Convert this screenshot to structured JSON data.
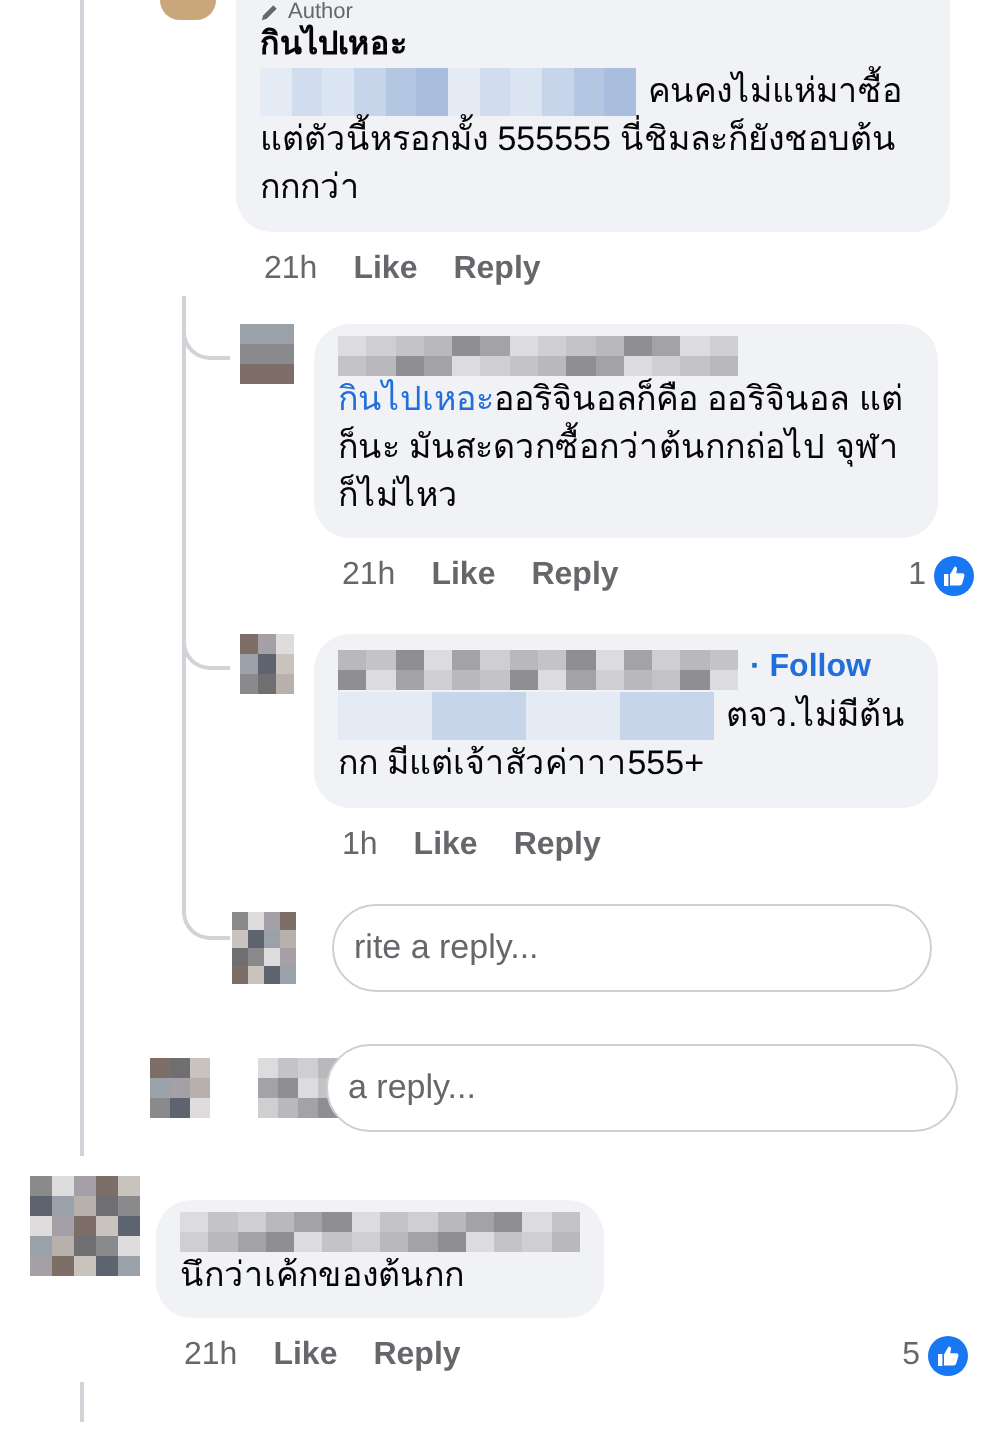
{
  "thread": [
    {
      "kind": "comment",
      "author_badge": "Author",
      "name": "กินไปเหอะ",
      "blurred_mention": true,
      "text_after_mention": "คนคงไม่แห่มาซื้อ",
      "text": "แต่ตัวนี้หรอกมั้ง 555555 นี่ชิมละก็ยังชอบต้นกกกว่า",
      "time": "21h",
      "like": "Like",
      "reply": "Reply",
      "children": [
        {
          "kind": "comment",
          "mention": "กินไปเหอะ",
          "text": "ออริจินอลก็คือ ออริจินอล แต่ก็นะ มันสะดวกซื้อกว่าต้นกกถ่อไป จุฬาก็ไม่ไหว",
          "time": "21h",
          "like": "Like",
          "reply": "Reply",
          "reaction_count": "1"
        },
        {
          "kind": "comment",
          "follow": "· Follow",
          "blurred_mention": true,
          "text_after_mention": "ตจว.ไม่มีต้น",
          "text": "กก  มีแต่เจ้าสัวค่าาา555+",
          "time": "1h",
          "like": "Like",
          "reply": "Reply"
        },
        {
          "kind": "reply_field",
          "placeholder": "rite a reply..."
        }
      ]
    },
    {
      "kind": "reply_field",
      "placeholder": "a reply..."
    }
  ],
  "comments": [
    {
      "kind": "comment",
      "text": "นึกว่าเค้กของต้นกก",
      "time": "21h",
      "like": "Like",
      "reply": "Reply",
      "reaction_count": "5"
    }
  ]
}
